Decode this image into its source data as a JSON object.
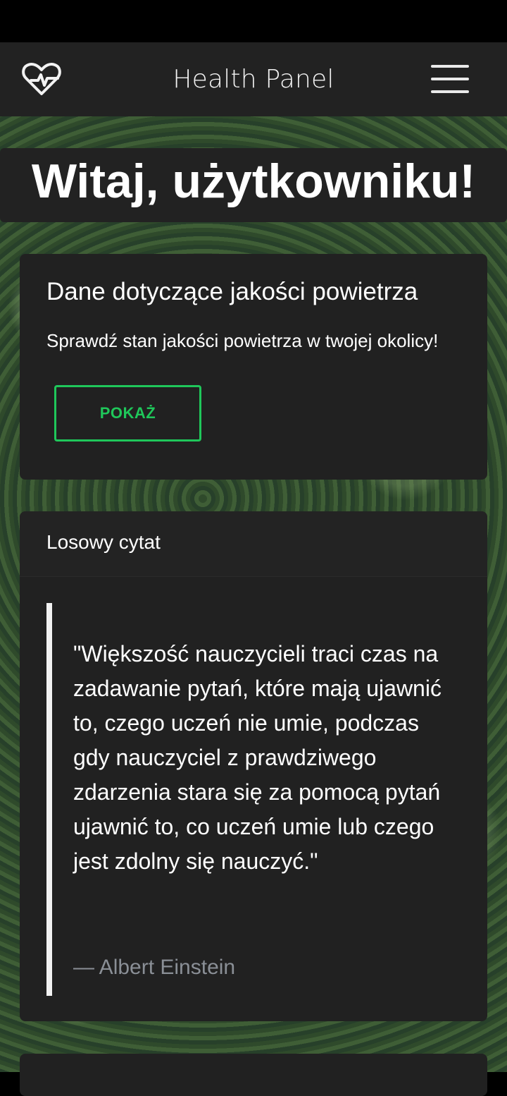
{
  "app": {
    "title": "Health Panel",
    "logo_icon": "heart-pulse-icon",
    "menu_icon": "hamburger-menu-icon"
  },
  "welcome": {
    "heading": "Witaj, użytkowniku!"
  },
  "air_quality": {
    "title": "Dane dotyczące jakości powietrza",
    "description": "Sprawdź stan jakości powietrza w twojej okolicy!",
    "button_label": "POKAŻ"
  },
  "quote": {
    "header": "Losowy cytat",
    "text": "\"Większość nauczycieli traci czas na zadawanie pytań, które mają ujawnić to, czego uczeń nie umie, podczas gdy nauczyciel z prawdziwego zdarzenia stara się za pomocą pytań ujawnić to, co uczeń umie lub czego jest zdolny się nauczyć.\"",
    "author": "— Albert Einstein"
  },
  "colors": {
    "navbar": "#222222",
    "card": "#212121",
    "accent_green": "#1fc75a",
    "author_gray": "#8a8f96"
  }
}
